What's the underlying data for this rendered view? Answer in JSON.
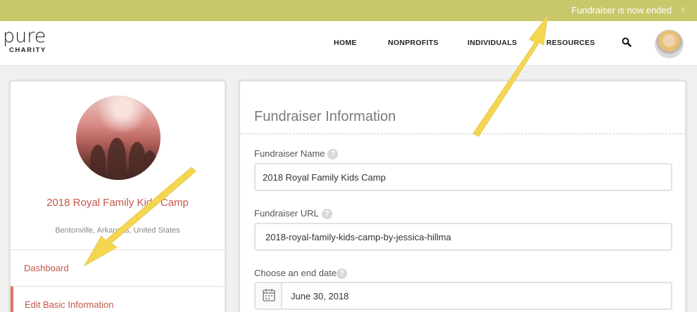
{
  "banner": {
    "message": "Fundraiser is now ended",
    "close": "×"
  },
  "logo": {
    "line1": "pure",
    "line2": "CHARITY"
  },
  "nav": {
    "home": "HOME",
    "nonprofits": "NONPROFITS",
    "individuals": "INDIVIDUALS",
    "resources": "RESOURCES"
  },
  "sidebar": {
    "camp_name": "2018 Royal Family Kids Camp",
    "location": "Bentonville, Arkansas, United States",
    "menu": [
      "Dashboard",
      "Edit Basic Information"
    ]
  },
  "form": {
    "title": "Fundraiser Information",
    "name_label": "Fundraiser Name",
    "name_value": "2018 Royal Family Kids Camp",
    "url_label": "Fundraiser URL",
    "url_value": "2018-royal-family-kids-camp-by-jessica-hillma",
    "date_label": "Choose an end date",
    "date_value": "June 30, 2018",
    "help_glyph": "?"
  },
  "colors": {
    "banner": "#c8c86b",
    "accent": "#c2574a",
    "arrow": "#f5d651"
  },
  "icons": [
    "close-icon",
    "search-icon",
    "help-icon",
    "calendar-icon",
    "arrow-annotation"
  ]
}
